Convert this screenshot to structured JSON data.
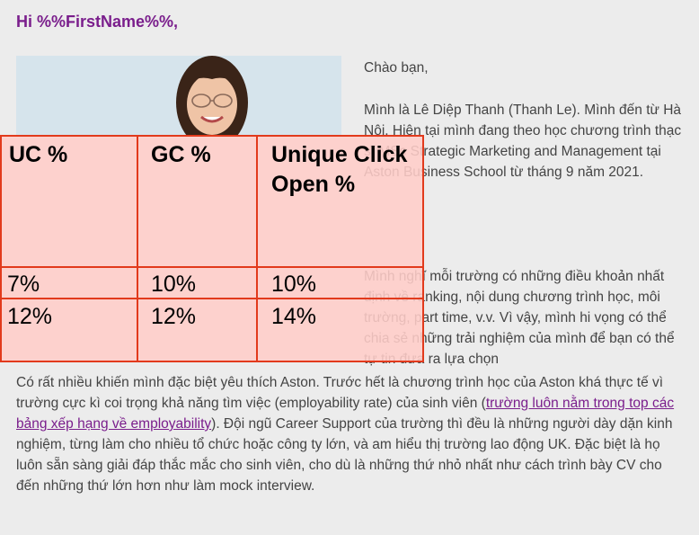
{
  "email": {
    "greeting": "Hi %%FirstName%%,",
    "p_hello": "Chào bạn,",
    "p_intro": "Mình là Lê Diệp Thanh (Thanh Le). Mình đến từ Hà Nội. Hiện tại mình đang theo học chương trình thạc sĩ MSc Strategic Marketing and Management tại Aston Business School từ tháng 9 năm 2021.",
    "p_second": "Mình nghĩ mỗi trường có những điều khoản nhất định về ranking, nội dung chương trình học, môi trường, part time, v.v. Vì vậy, mình hi vọng có thể chia sẻ những trải nghiệm của mình để bạn có thể tự tin đưa ra lựa chọn",
    "lower_before_link": "Có rất nhiều khiến mình đặc biệt yêu thích Aston. Trước hết là chương trình học của Aston khá thực tế vì trường cực kì coi trọng khả năng tìm việc (employability rate) của sinh viên (",
    "lower_link": "trường luôn nằm trong top các bảng xếp hạng về employability",
    "lower_after_link": "). Đội ngũ Career Support của trường thì đều là những người dày dặn kinh nghiệm, từng làm cho nhiều tổ chức hoặc công ty lớn, và am hiểu thị trường lao động UK. Đặc biệt là họ luôn sẵn sàng giải đáp thắc mắc cho sinh viên, cho dù là những thứ nhỏ nhất như cách trình bày CV cho đến những thứ lớn hơn như làm mock interview."
  },
  "stats_table": {
    "headers": [
      "UC %",
      "GC %",
      "Unique Click Open %"
    ],
    "rows": [
      [
        "7%",
        "10%",
        "10%"
      ],
      [
        "12%",
        "12%",
        "14%"
      ]
    ]
  },
  "colors": {
    "greeting": "#7a1e8c",
    "overlay_border": "#e23a1c",
    "overlay_fill": "#ffcdc8"
  }
}
